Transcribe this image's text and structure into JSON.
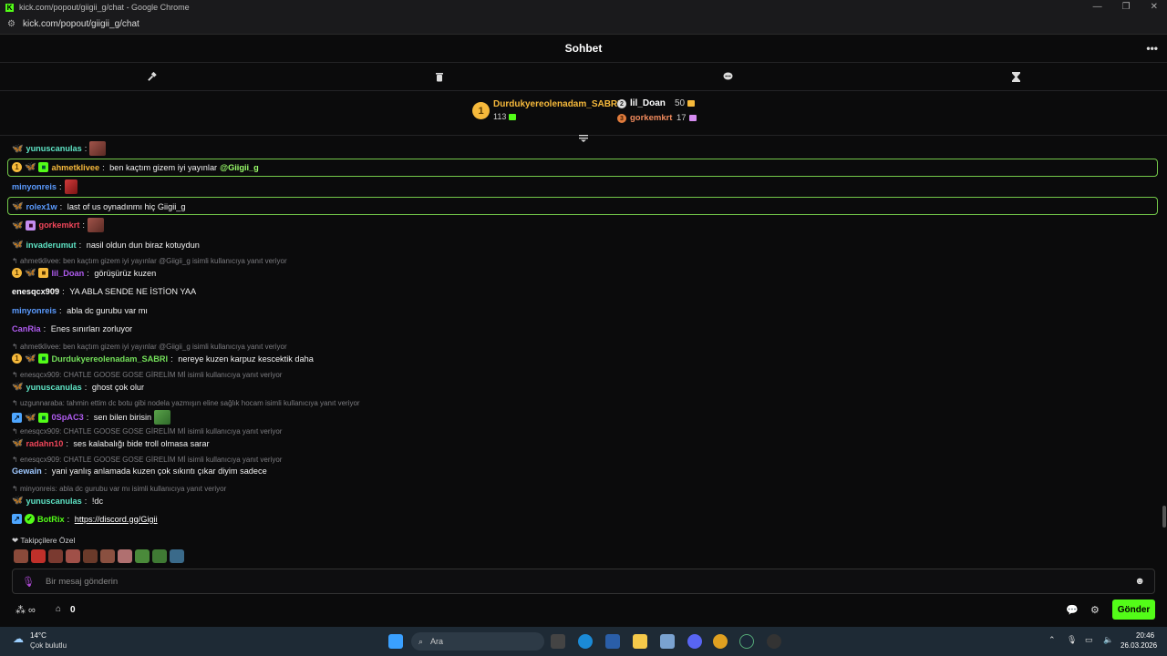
{
  "window": {
    "title": "kick.com/popout/giigii_g/chat - Google Chrome",
    "url": "kick.com/popout/giigii_g/chat"
  },
  "header": {
    "title": "Sohbet"
  },
  "leaderboard": {
    "first": {
      "rank": "1",
      "name": "Durdukyereolenadam_SABRI",
      "amount": "113"
    },
    "second": {
      "name": "lil_Doan",
      "amount": "50"
    },
    "third": {
      "name": "gorkemkrt",
      "amount": "17"
    }
  },
  "chat": {
    "m1": {
      "user": "yunuscanulas",
      "text": ""
    },
    "m2": {
      "user": "ahmetklivee",
      "text": "ben kaçtım gizem iyi yayınlar ",
      "mention": "@Giigii_g"
    },
    "m3": {
      "user": "minyonreis",
      "text": ""
    },
    "m4": {
      "user": "rolex1w",
      "text": "last of us oynadınmı hiç Giigii_g"
    },
    "m5": {
      "user": "gorkemkrt",
      "text": ""
    },
    "m6": {
      "user": "invaderumut",
      "text": "nasil oldun dun biraz kotuydun"
    },
    "r7": "ahmetklivee: ben kaçtım gizem iyi yayınlar @Giigii_g isimli kullanıcıya yanıt veriyor",
    "m7": {
      "user": "lil_Doan",
      "text": "görüşürüz kuzen"
    },
    "m8": {
      "user": "enesqcx909",
      "text": "YA ABLA SENDE NE İSTİON YAA"
    },
    "m9": {
      "user": "minyonreis",
      "text": "abla dc gurubu var mı"
    },
    "m10": {
      "user": "CanRia",
      "text": "Enes sınırları zorluyor"
    },
    "r11": "ahmetklivee: ben kaçtım gizem iyi yayınlar @Giigii_g isimli kullanıcıya yanıt veriyor",
    "m11": {
      "user": "Durdukyereolenadam_SABRI",
      "text": "nereye kuzen karpuz kescektik daha"
    },
    "r12": "enesqcx909: CHATLE GOOSE GOSE GİRELİM Mİ isimli kullanıcıya yanıt veriyor",
    "m12": {
      "user": "yunuscanulas",
      "text": "ghost çok olur"
    },
    "r13": "uzgunnaraba: tahmin ettim dc botu gibi nodela yazmışın eline sağlık hocam isimli kullanıcıya yanıt veriyor",
    "m13": {
      "user": "0SpAC3",
      "text": "sen bilen birisin"
    },
    "r14": "enesqcx909: CHATLE GOOSE GOSE GİRELİM Mİ isimli kullanıcıya yanıt veriyor",
    "m14": {
      "user": "radahn10",
      "text": "ses kalabalığı bide troll olmasa sarar"
    },
    "r15": "enesqcx909: CHATLE GOOSE GOSE GİRELİM Mİ isimli kullanıcıya yanıt veriyor",
    "m15": {
      "user": "Gewain",
      "text": "yani yanlış anlamada kuzen çok sıkıntı çıkar diyim sadece"
    },
    "r16": "minyonreis: abla dc gurubu var mı isimli kullanıcıya yanıt veriyor",
    "m16": {
      "user": "yunuscanulas",
      "text": "!dc"
    },
    "m17": {
      "user": "BotRix",
      "text": "https://discord.gg/Gigii"
    }
  },
  "emote_panel": {
    "label": "Takipçilere Özel"
  },
  "input": {
    "placeholder": "Bir mesaj gönderin"
  },
  "bottom": {
    "points": "0",
    "send_label": "Gönder"
  },
  "taskbar": {
    "weather_temp": "14°C",
    "weather_text": "Çok bulutlu",
    "search_label": "Ara",
    "time": "20:46",
    "date": "26.03.2026"
  },
  "colors": {
    "accent": "#53fc18",
    "highlight_border": "#74c94a"
  }
}
